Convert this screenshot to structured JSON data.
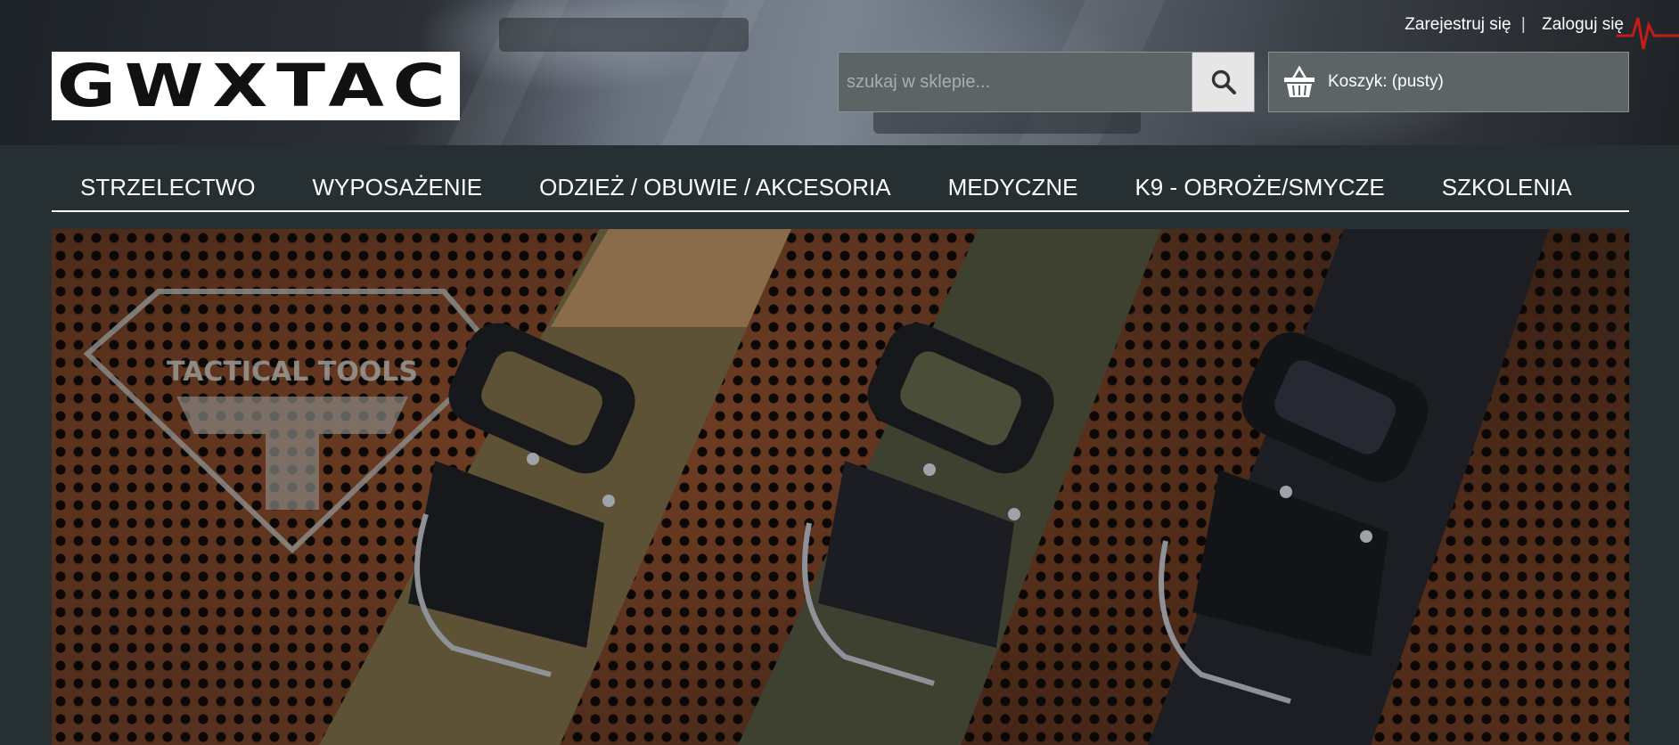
{
  "header": {
    "top_links": {
      "register": "Zarejestruj się",
      "login": "Zaloguj się"
    },
    "logo_text": "GWXTAC",
    "search": {
      "placeholder": "szukaj w sklepie...",
      "button_icon": "search-icon"
    },
    "cart": {
      "icon": "basket-icon",
      "label": "Koszyk: (pusty)"
    }
  },
  "nav": {
    "items": [
      {
        "label": "STRZELECTWO"
      },
      {
        "label": "WYPOSAŻENIE"
      },
      {
        "label": "ODZIEŻ / OBUWIE / AKCESORIA"
      },
      {
        "label": "MEDYCZNE"
      },
      {
        "label": "K9 - OBROŻE/SMYCZE"
      },
      {
        "label": "SZKOLENIA"
      }
    ]
  },
  "banner": {
    "logo_text": "TACTICAL TOOLS",
    "colors": {
      "belt_coyote": "#5e5236",
      "belt_olive": "#3e4130",
      "belt_black": "#1c1e24",
      "buckle": "#16181c"
    }
  },
  "colors": {
    "page_bg": "#263033",
    "box_bg": "#5d6466",
    "accent_white": "#ffffff"
  }
}
